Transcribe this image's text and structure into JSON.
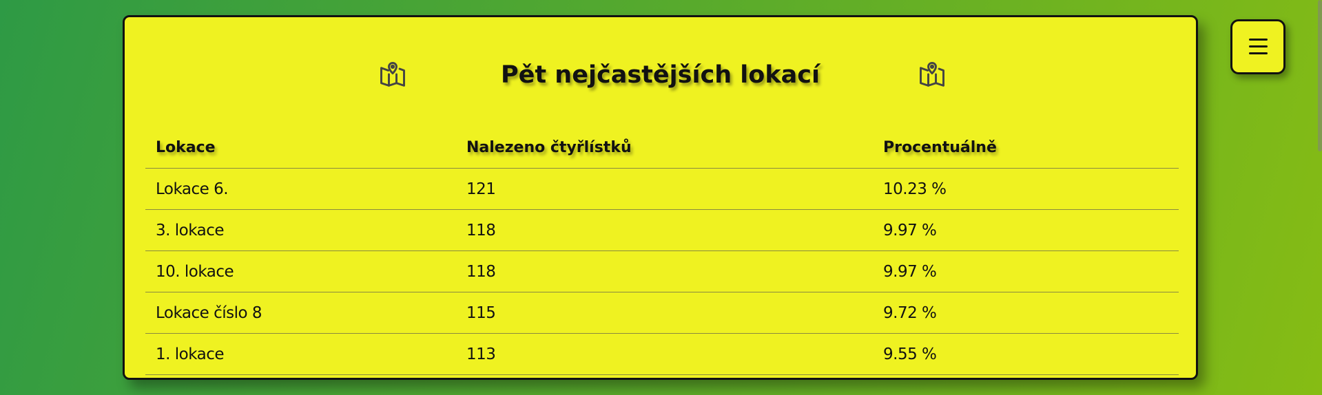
{
  "panel": {
    "title": "Pět nejčastějších lokací",
    "left_icon": "map-pin-icon",
    "right_icon": "map-pin-icon"
  },
  "table": {
    "headers": [
      "Lokace",
      "Nalezeno čtyřlístků",
      "Procentuálně"
    ],
    "rows": [
      [
        "Lokace 6.",
        "121",
        "10.23 %"
      ],
      [
        "3. lokace",
        "118",
        "9.97 %"
      ],
      [
        "10. lokace",
        "118",
        "9.97 %"
      ],
      [
        "Lokace číslo 8",
        "115",
        "9.72 %"
      ],
      [
        "1. lokace",
        "113",
        "9.55 %"
      ]
    ]
  },
  "menu": {
    "icon": "hamburger-menu-icon"
  },
  "colors": {
    "panel_background": "#eff221",
    "gradient_start": "#2e9a45",
    "gradient_end": "#86bc14"
  }
}
